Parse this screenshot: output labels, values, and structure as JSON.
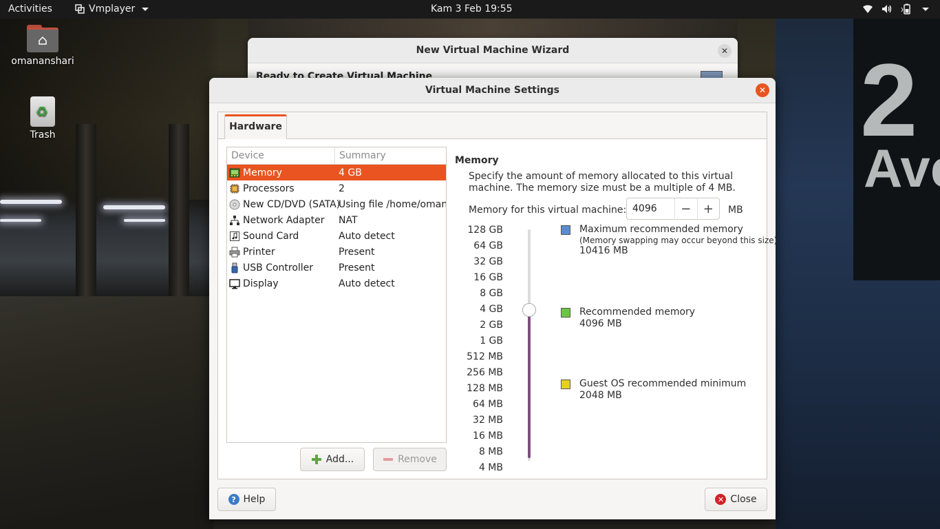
{
  "topbar": {
    "activities": "Activities",
    "app_name": "Vmplayer",
    "clock": "Kam  3 Feb  19:55"
  },
  "desktop": {
    "home_label": "omananshari",
    "trash_label": "Trash",
    "bg_sign_number": "2",
    "bg_sign_text": "Ave"
  },
  "wizard": {
    "title": "New Virtual Machine Wizard",
    "heading": "Ready to Create Virtual Machine",
    "close_glyph": "✕"
  },
  "dialog": {
    "title": "Virtual Machine Settings",
    "close_glyph": "✕",
    "tab_hardware": "Hardware",
    "columns": {
      "device": "Device",
      "summary": "Summary"
    },
    "devices": [
      {
        "name": "Memory",
        "summary": "4 GB",
        "icon": "memory-icon",
        "selected": true
      },
      {
        "name": "Processors",
        "summary": "2",
        "icon": "processor-icon",
        "selected": false
      },
      {
        "name": "New CD/DVD (SATA)",
        "summary": "Using file /home/omana",
        "icon": "cd-icon",
        "selected": false
      },
      {
        "name": "Network Adapter",
        "summary": "NAT",
        "icon": "network-icon",
        "selected": false
      },
      {
        "name": "Sound Card",
        "summary": "Auto detect",
        "icon": "sound-icon",
        "selected": false
      },
      {
        "name": "Printer",
        "summary": "Present",
        "icon": "printer-icon",
        "selected": false
      },
      {
        "name": "USB Controller",
        "summary": "Present",
        "icon": "usb-icon",
        "selected": false
      },
      {
        "name": "Display",
        "summary": "Auto detect",
        "icon": "display-icon",
        "selected": false
      }
    ],
    "add_label": "Add...",
    "remove_label": "Remove",
    "help_label": "Help",
    "close_label": "Close"
  },
  "memory": {
    "title": "Memory",
    "description": "Specify the amount of memory allocated to this virtual machine. The memory size must be a multiple of 4 MB.",
    "field_label": "Memory for this virtual machine:",
    "value": "4096",
    "minus": "−",
    "plus": "+",
    "unit": "MB",
    "scale": [
      "128 GB",
      "64 GB",
      "32 GB",
      "16 GB",
      "8 GB",
      "4 GB",
      "2 GB",
      "1 GB",
      "512 MB",
      "256 MB",
      "128 MB",
      "64 MB",
      "32 MB",
      "16 MB",
      "8 MB",
      "4 MB"
    ],
    "legend": {
      "max_label": "Maximum recommended memory",
      "max_note": "(Memory swapping may occur beyond this size)",
      "max_value": "10416 MB",
      "max_color": "#5b8bd0",
      "rec_label": "Recommended memory",
      "rec_value": "4096 MB",
      "rec_color": "#6cc644",
      "min_label": "Guest OS recommended minimum",
      "min_value": "2048 MB",
      "min_color": "#e6d21e"
    }
  }
}
